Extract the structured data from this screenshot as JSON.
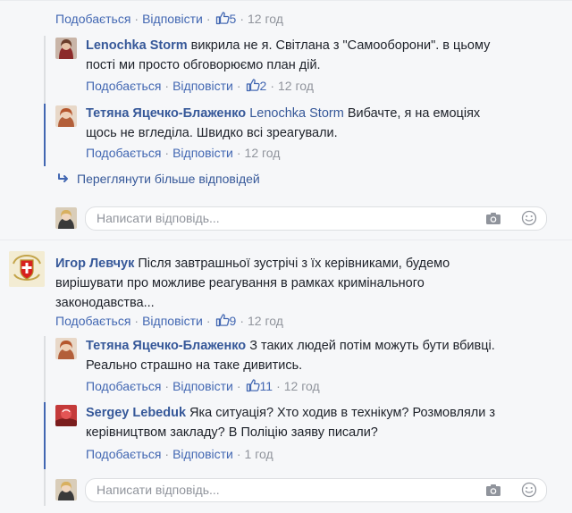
{
  "comments": {
    "top_meta": {
      "like": "Подобається",
      "reply": "Відповісти",
      "likes": "5",
      "time": "12 год"
    },
    "reply1": {
      "author": "Lenochka Storm",
      "text1": " викрила не я. Світлана з \"Самооборони\". в цьому",
      "text2": "пості ми просто обговорюємо план дій.",
      "like": "Подобається",
      "reply": "Відповісти",
      "likes": "2",
      "time": "12 год"
    },
    "reply2": {
      "author": "Тетяна Яцечко-Блаженко",
      "mention": "Lenochka Storm",
      "text1": " Вибачте, я на емоціях",
      "text2": "щось не вгледіла. Швидко всі зреагували.",
      "like": "Подобається",
      "reply": "Відповісти",
      "time": "12 год"
    },
    "more_replies": "Переглянути більше відповідей",
    "reply_placeholder": "Написати відповідь...",
    "comment2": {
      "author": "Игор Левчук",
      "text1": " Після завтрашньої зустрічі з їх керівниками, будемо",
      "text2": "вирішувати про можливе реагування в рамках кримінального",
      "text3": "законодавства...",
      "like": "Подобається",
      "reply": "Відповісти",
      "likes": "9",
      "time": "12 год"
    },
    "reply3": {
      "author": "Тетяна Яцечко-Блаженко",
      "text1": " З таких людей потім можуть бути вбивці.",
      "text2": "Реально страшно на таке дивитись.",
      "like": "Подобається",
      "reply": "Відповісти",
      "likes": "11",
      "time": "12 год"
    },
    "reply4": {
      "author": "Sergey Lebeduk",
      "text1": " Яка ситуація? Хто ходив в технікум? Розмовляли з",
      "text2": "керівництвом закладу? В Поліцію заяву писали?",
      "like": "Подобається",
      "reply": "Відповісти",
      "time": "1 год"
    }
  },
  "colors": {
    "link": "#4267b2",
    "author": "#365899",
    "muted": "#90949c",
    "background": "#f6f7f9"
  }
}
